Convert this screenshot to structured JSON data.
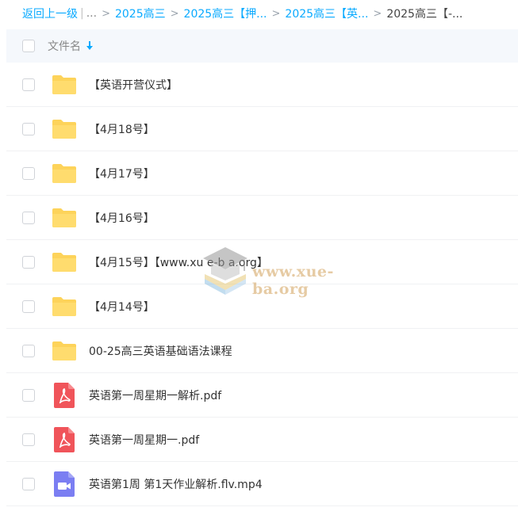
{
  "breadcrumb": {
    "back_label": "返回上一级",
    "pipe": "|",
    "ellipsis": "...",
    "sep": ">",
    "items": [
      "2025高三",
      "2025高三【押...",
      "2025高三【英..."
    ],
    "current": "2025高三【-..."
  },
  "header": {
    "column_label": "文件名"
  },
  "files": [
    {
      "type": "folder",
      "name": "【英语开营仪式】"
    },
    {
      "type": "folder",
      "name": "【4月18号】"
    },
    {
      "type": "folder",
      "name": "【4月17号】"
    },
    {
      "type": "folder",
      "name": "【4月16号】"
    },
    {
      "type": "folder",
      "name": "【4月15号】【www.xu e-b a.org】"
    },
    {
      "type": "folder",
      "name": "【4月14号】"
    },
    {
      "type": "folder",
      "name": "00-25高三英语基础语法课程"
    },
    {
      "type": "pdf",
      "name": "英语第一周星期一解析.pdf"
    },
    {
      "type": "pdf",
      "name": "英语第一周星期一.pdf"
    },
    {
      "type": "video",
      "name": "英语第1周 第1天作业解析.flv.mp4"
    }
  ],
  "watermark": {
    "text": "www.xue-ba.org"
  },
  "colors": {
    "accent": "#09aaff",
    "folder": "#fdd35a",
    "pdf": "#f0545a",
    "video": "#7b7ef2"
  }
}
